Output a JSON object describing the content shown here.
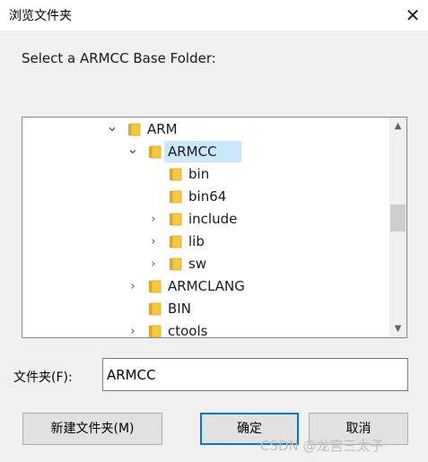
{
  "window": {
    "title": "浏览文件夹",
    "close_glyph": "✕"
  },
  "instruction": "Select a ARMCC Base Folder:",
  "tree": {
    "items": [
      {
        "label": "ARM",
        "expander": "⌄",
        "selected": false
      },
      {
        "label": "ARMCC",
        "expander": "⌄",
        "selected": true
      },
      {
        "label": "bin",
        "expander": "",
        "selected": false
      },
      {
        "label": "bin64",
        "expander": "",
        "selected": false
      },
      {
        "label": "include",
        "expander": "›",
        "selected": false
      },
      {
        "label": "lib",
        "expander": "›",
        "selected": false
      },
      {
        "label": "sw",
        "expander": "›",
        "selected": false
      },
      {
        "label": "ARMCLANG",
        "expander": "›",
        "selected": false
      },
      {
        "label": "BIN",
        "expander": "",
        "selected": false
      },
      {
        "label": "ctools",
        "expander": "›",
        "selected": false
      }
    ],
    "folder_color": "#f5c842",
    "selection_color": "#cce8ff"
  },
  "scrollbar": {
    "up_glyph": "▲",
    "down_glyph": "▼"
  },
  "folder_field": {
    "label": "文件夹(F):",
    "value": "ARMCC"
  },
  "buttons": {
    "new_folder": "新建文件夹(M)",
    "ok": "确定",
    "cancel": "取消"
  },
  "watermark": "CSDN @龙宫三太子"
}
